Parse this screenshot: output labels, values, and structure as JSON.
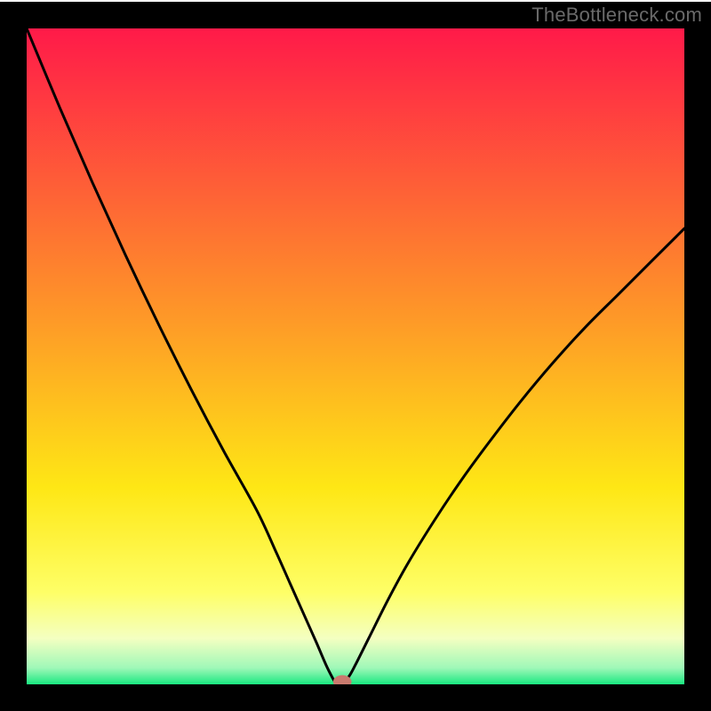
{
  "watermark": "TheBottleneck.com",
  "chart_data": {
    "type": "line",
    "title": "",
    "xlabel": "",
    "ylabel": "",
    "xlim": [
      0,
      100
    ],
    "ylim": [
      0,
      100
    ],
    "grid": false,
    "legend": false,
    "background": {
      "type": "vertical-gradient",
      "stops": [
        {
          "offset": 0.0,
          "color": "#ff1a49"
        },
        {
          "offset": 0.45,
          "color": "#fe9b27"
        },
        {
          "offset": 0.7,
          "color": "#fee715"
        },
        {
          "offset": 0.86,
          "color": "#feff67"
        },
        {
          "offset": 0.93,
          "color": "#f4ffc1"
        },
        {
          "offset": 0.975,
          "color": "#9ff8b8"
        },
        {
          "offset": 1.0,
          "color": "#19e880"
        }
      ]
    },
    "curve": {
      "description": "V-shaped bottleneck curve with asymmetric arms and rounded minimum",
      "minimum_x": 47,
      "points": [
        {
          "x": 0.0,
          "y": 100.0
        },
        {
          "x": 5.0,
          "y": 88.0
        },
        {
          "x": 10.0,
          "y": 76.5
        },
        {
          "x": 15.0,
          "y": 65.5
        },
        {
          "x": 20.0,
          "y": 55.0
        },
        {
          "x": 25.0,
          "y": 45.0
        },
        {
          "x": 30.0,
          "y": 35.5
        },
        {
          "x": 35.0,
          "y": 26.5
        },
        {
          "x": 38.0,
          "y": 20.0
        },
        {
          "x": 40.0,
          "y": 15.5
        },
        {
          "x": 42.0,
          "y": 11.0
        },
        {
          "x": 44.0,
          "y": 6.5
        },
        {
          "x": 45.5,
          "y": 3.0
        },
        {
          "x": 46.5,
          "y": 1.0
        },
        {
          "x": 47.0,
          "y": 0.2
        },
        {
          "x": 47.5,
          "y": 0.0
        },
        {
          "x": 48.0,
          "y": 0.2
        },
        {
          "x": 49.0,
          "y": 1.2
        },
        {
          "x": 50.0,
          "y": 3.0
        },
        {
          "x": 52.0,
          "y": 7.0
        },
        {
          "x": 55.0,
          "y": 13.0
        },
        {
          "x": 58.0,
          "y": 18.5
        },
        {
          "x": 62.0,
          "y": 25.0
        },
        {
          "x": 66.0,
          "y": 31.0
        },
        {
          "x": 70.0,
          "y": 36.5
        },
        {
          "x": 75.0,
          "y": 43.0
        },
        {
          "x": 80.0,
          "y": 49.0
        },
        {
          "x": 85.0,
          "y": 54.5
        },
        {
          "x": 90.0,
          "y": 59.5
        },
        {
          "x": 95.0,
          "y": 64.5
        },
        {
          "x": 100.0,
          "y": 69.5
        }
      ]
    },
    "marker": {
      "x": 48.0,
      "y": 0.4,
      "rx": 1.4,
      "ry": 1.0,
      "color": "#c97a6e"
    },
    "frame": {
      "stroke": "#000000",
      "stroke_width_outer": 30,
      "inner_top": 32,
      "inner_bottom": 30,
      "inner_left": 30,
      "inner_right": 30
    }
  }
}
